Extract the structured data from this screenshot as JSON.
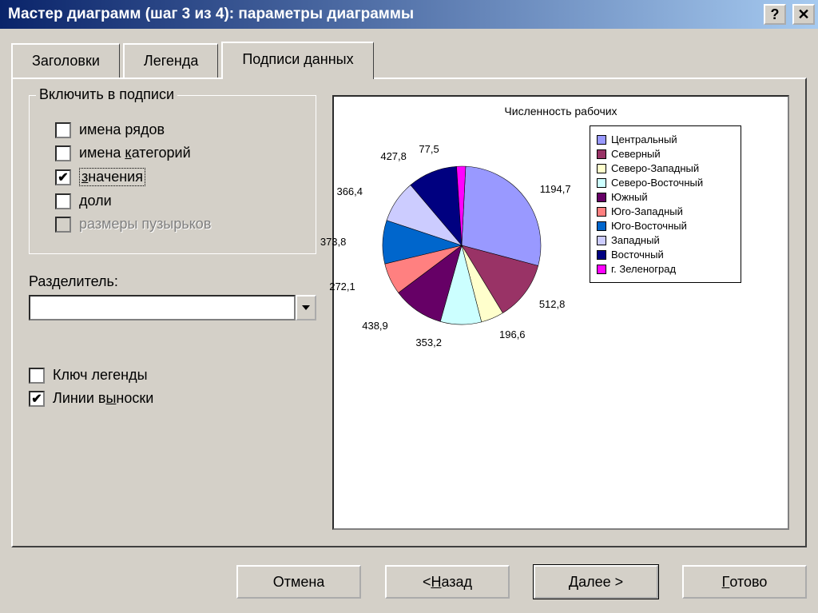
{
  "window": {
    "title": "Мастер диаграмм (шаг 3 из 4): параметры диаграммы"
  },
  "tabs": {
    "t1": "Заголовки",
    "t2": "Легенда",
    "t3": "Подписи данных"
  },
  "groupbox": {
    "title": "Включить в подписи",
    "series_names": "имена рядов",
    "category_names_pre": "имена ",
    "category_names_u": "к",
    "category_names_post": "атегорий",
    "values_u": "з",
    "values_post": "начения",
    "percent_u": "д",
    "percent_post": "оли",
    "bubble_sizes": "размеры пузырьков"
  },
  "separator": {
    "label_pre": "Раз",
    "label_u": "д",
    "label_post": "елитель:",
    "value": ""
  },
  "extra": {
    "legend_key": "Ключ легенды",
    "leader_lines_pre": "Линии в",
    "leader_lines_u": "ы",
    "leader_lines_post": "носки"
  },
  "chart_data": {
    "type": "pie",
    "title": "Численность рабочих",
    "series": [
      {
        "name": "Центральный",
        "value": 1194.7,
        "color": "#9999ff"
      },
      {
        "name": "Северный",
        "value": 512.8,
        "color": "#993366"
      },
      {
        "name": "Северо-Западный",
        "value": 196.6,
        "color": "#ffffcc"
      },
      {
        "name": "Северо-Восточный",
        "value": 353.2,
        "color": "#ccffff"
      },
      {
        "name": "Южный",
        "value": 438.9,
        "color": "#660066"
      },
      {
        "name": "Юго-Западный",
        "value": 272.1,
        "color": "#ff8080"
      },
      {
        "name": "Юго-Восточный",
        "value": 373.8,
        "color": "#0066cc"
      },
      {
        "name": "Западный",
        "value": 366.4,
        "color": "#ccccff"
      },
      {
        "name": "Восточный",
        "value": 427.8,
        "color": "#000080"
      },
      {
        "name": "г. Зеленоград",
        "value": 77.5,
        "color": "#ff00ff"
      }
    ],
    "data_labels": [
      "1194,7",
      "512,8",
      "196,6",
      "353,2",
      "438,9",
      "272,1",
      "373,8",
      "366,4",
      "427,8",
      "77,5"
    ],
    "legend_labels": [
      "Центральный",
      "Северный",
      "Северо-Западный",
      "Северо-Восточный",
      "Южный",
      "Юго-Западный",
      "Юго-Восточный",
      "Западный",
      "Восточный",
      "г. Зеленоград"
    ]
  },
  "buttons": {
    "cancel": "Отмена",
    "back_pre": "< ",
    "back_u": "Н",
    "back_post": "азад",
    "next_pre": "",
    "next_u": "Д",
    "next_post": "алее >",
    "finish_u": "Г",
    "finish_post": "отово"
  }
}
